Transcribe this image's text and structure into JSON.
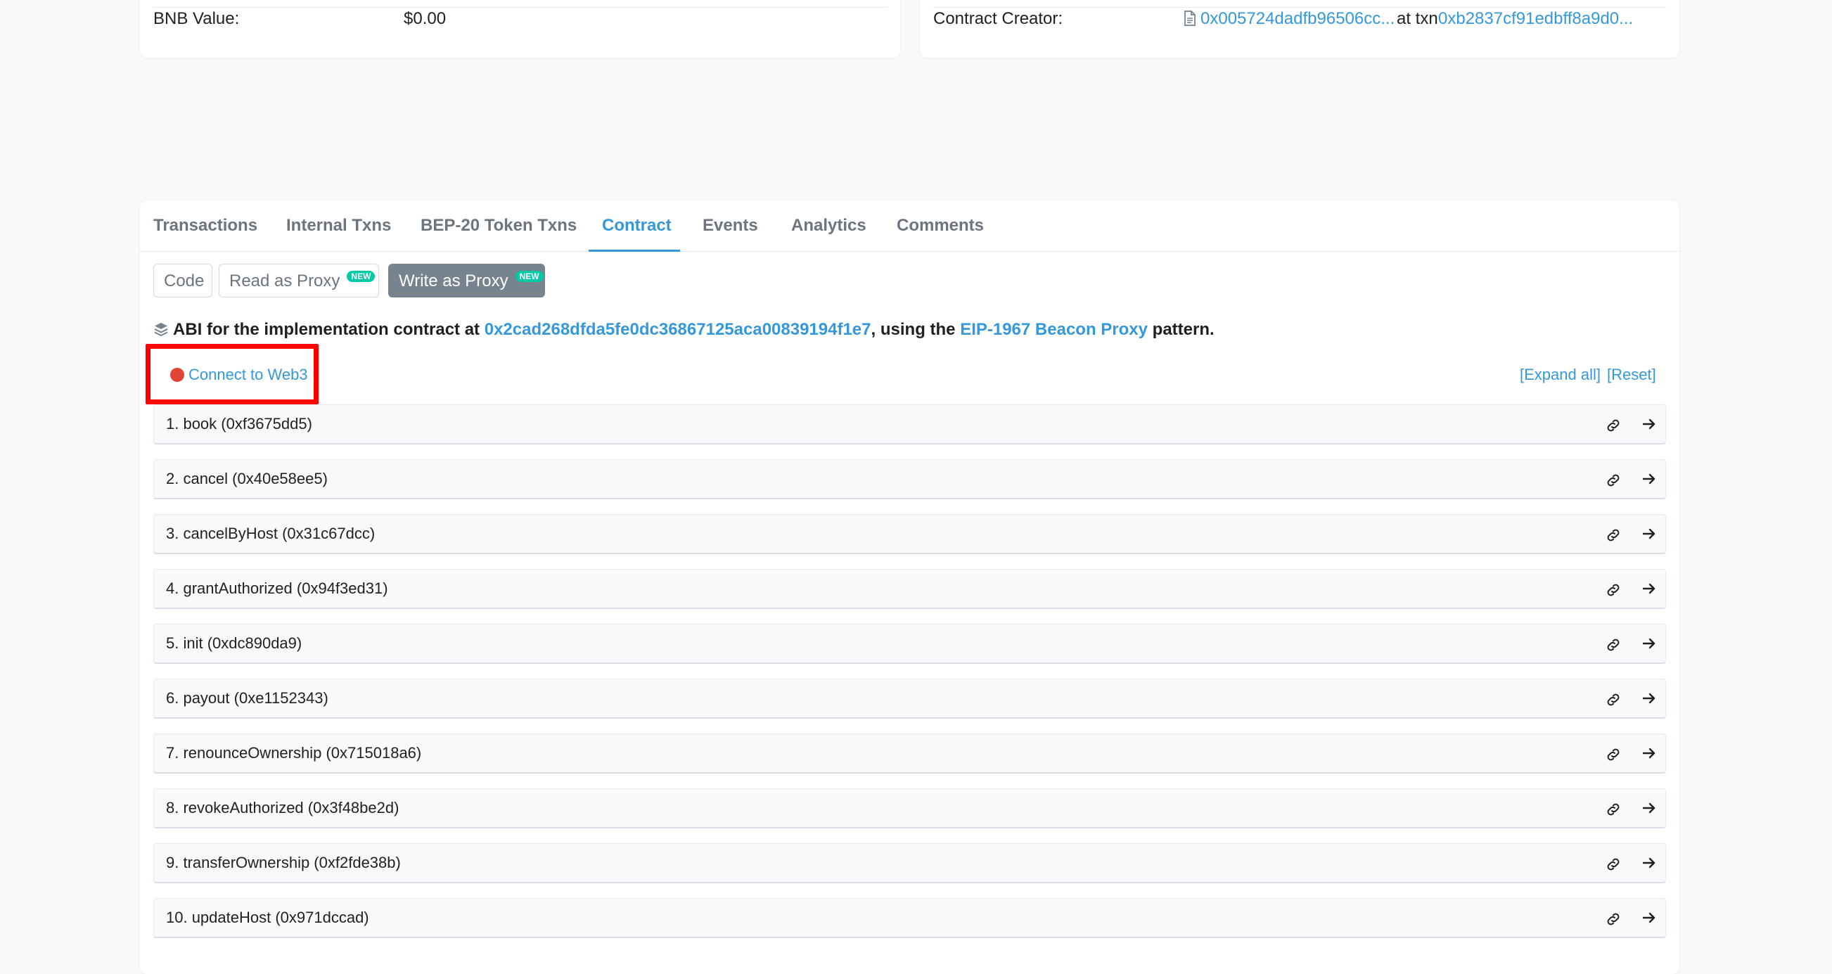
{
  "top_left": {
    "label": "BNB Value:",
    "value": "$0.00"
  },
  "top_right": {
    "label": "Contract Creator:",
    "creator": "0x005724dadfb96506cc...",
    "at_txn": "at txn",
    "txn": "0xb2837cf91edbff8a9d0..."
  },
  "tabs": [
    {
      "label": "Transactions"
    },
    {
      "label": "Internal Txns"
    },
    {
      "label": "BEP-20 Token Txns"
    },
    {
      "label": "Contract"
    },
    {
      "label": "Events"
    },
    {
      "label": "Analytics"
    },
    {
      "label": "Comments"
    }
  ],
  "active_tab": "Contract",
  "sub_buttons": {
    "code": "Code",
    "read_proxy": "Read as Proxy",
    "write_proxy": "Write as Proxy",
    "new_badge": "NEW"
  },
  "abi": {
    "prefix": "ABI for the implementation contract at",
    "address": "0x2cad268dfda5fe0dc36867125aca00839194f1e7",
    "middle": ", using the",
    "pattern_link": "EIP-1967 Beacon Proxy",
    "suffix": "pattern."
  },
  "connect_label": "Connect to Web3",
  "expand_all": "[Expand all]",
  "reset": "[Reset]",
  "functions": [
    "1. book (0xf3675dd5)",
    "2. cancel (0x40e58ee5)",
    "3. cancelByHost (0x31c67dcc)",
    "4. grantAuthorized (0x94f3ed31)",
    "5. init (0xdc890da9)",
    "6. payout (0xe1152343)",
    "7. renounceOwnership (0x715018a6)",
    "8. revokeAuthorized (0x3f48be2d)",
    "9. transferOwnership (0xf2fde38b)",
    "10. updateHost (0x971dccad)"
  ],
  "colors": {
    "accent": "#3498db",
    "status_dot": "#de4437",
    "highlight": "#ff0000",
    "badge": "#00c9a7"
  }
}
